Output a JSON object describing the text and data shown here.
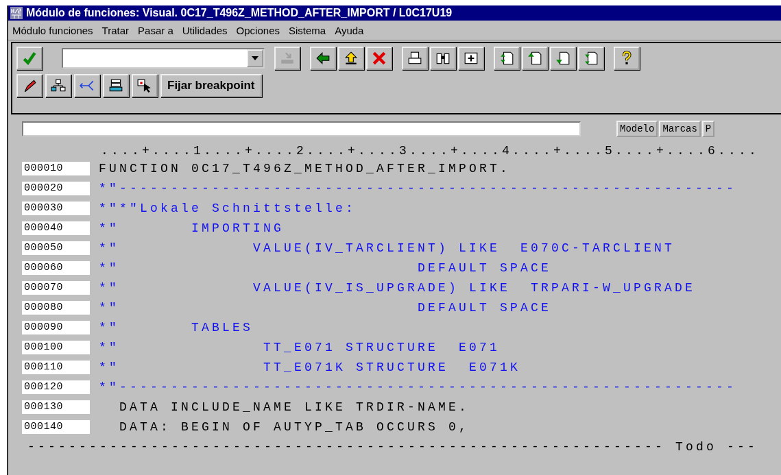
{
  "window": {
    "title": "Módulo de funciones: Visual. 0C17_T496Z_METHOD_AFTER_IMPORT / L0C17U19"
  },
  "menu": [
    "Módulo funciones",
    "Tratar",
    "Pasar a",
    "Utilidades",
    "Opciones",
    "Sistema",
    "Ayuda"
  ],
  "toolbar_button": "Fijar breakpoint",
  "editor_buttons": [
    "Modelo",
    "Marcas",
    "P"
  ],
  "ruler": "....+....1....+....2....+....3....+....4....+....5....+....6....",
  "code_lines": [
    {
      "number": "000010",
      "kind": "code",
      "text": "FUNCTION 0C17_T496Z_METHOD_AFTER_IMPORT."
    },
    {
      "number": "000020",
      "kind": "comment",
      "text": "*\"------------------------------------------------------------"
    },
    {
      "number": "000030",
      "kind": "comment",
      "text": "*\"*\"Lokale Schnittstelle:"
    },
    {
      "number": "000040",
      "kind": "comment",
      "text": "*\"       IMPORTING"
    },
    {
      "number": "000050",
      "kind": "comment",
      "text": "*\"             VALUE(IV_TARCLIENT) LIKE  E070C-TARCLIENT"
    },
    {
      "number": "000060",
      "kind": "comment",
      "text": "*\"                             DEFAULT SPACE"
    },
    {
      "number": "000070",
      "kind": "comment",
      "text": "*\"             VALUE(IV_IS_UPGRADE) LIKE  TRPARI-W_UPGRADE"
    },
    {
      "number": "000080",
      "kind": "comment",
      "text": "*\"                             DEFAULT SPACE"
    },
    {
      "number": "000090",
      "kind": "comment",
      "text": "*\"       TABLES"
    },
    {
      "number": "000100",
      "kind": "comment",
      "text": "*\"              TT_E071 STRUCTURE  E071"
    },
    {
      "number": "000110",
      "kind": "comment",
      "text": "*\"              TT_E071K STRUCTURE  E071K"
    },
    {
      "number": "000120",
      "kind": "comment",
      "text": "*\"------------------------------------------------------------"
    },
    {
      "number": "000130",
      "kind": "code",
      "text": "  DATA INCLUDE_NAME LIKE TRDIR-NAME."
    },
    {
      "number": "000140",
      "kind": "code",
      "text": "  DATA: BEGIN OF AUTYP_TAB OCCURS 0,"
    }
  ],
  "footer_rule": "-------------------------------------------------------------- Todo ---"
}
